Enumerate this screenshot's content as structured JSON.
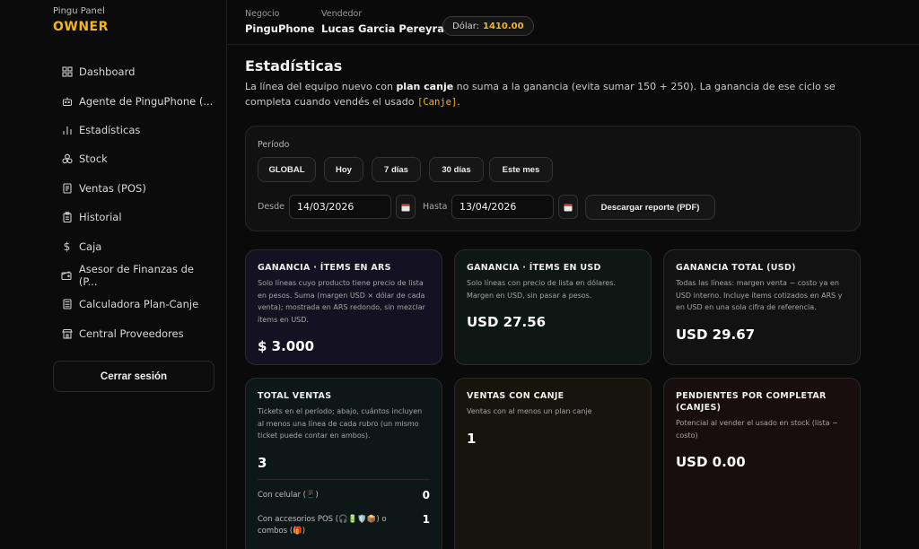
{
  "sidebar": {
    "brand_small": "Pingu Panel",
    "brand_big": "OWNER",
    "items": [
      {
        "label": "Dashboard",
        "icon": "grid-icon"
      },
      {
        "label": "Agente de PinguPhone (...",
        "icon": "bot-icon"
      },
      {
        "label": "Estadísticas",
        "icon": "bar-chart-icon"
      },
      {
        "label": "Stock",
        "icon": "boxes-icon"
      },
      {
        "label": "Ventas (POS)",
        "icon": "receipt-icon"
      },
      {
        "label": "Historial",
        "icon": "clipboard-icon"
      },
      {
        "label": "Caja",
        "icon": "dollar-icon"
      },
      {
        "label": "Asesor de Finanzas de (P...",
        "icon": "wallet-icon"
      },
      {
        "label": "Calculadora Plan-Canje",
        "icon": "calculator-icon"
      },
      {
        "label": "Central Proveedores",
        "icon": "store-icon"
      }
    ],
    "logout_label": "Cerrar sesión"
  },
  "topbar": {
    "negocio_label": "Negocio",
    "negocio_value": "PinguPhone",
    "vendedor_label": "Vendedor",
    "vendedor_value": "Lucas Garcia Pereyra",
    "dolar_label": "Dólar:",
    "dolar_value": "1410.00"
  },
  "main": {
    "title": "Estadísticas",
    "desc_1": "La línea del equipo nuevo con ",
    "desc_bold": "plan canje",
    "desc_2": " no suma a la ganancia (evita sumar 150 + 250). La ganancia de ese ciclo se completa cuando vendés el usado ",
    "desc_code": "[Canje]",
    "desc_3": "."
  },
  "period": {
    "label": "Período",
    "buttons": [
      "GLOBAL",
      "Hoy",
      "7 días",
      "30 días",
      "Este mes"
    ],
    "desde_label": "Desde",
    "desde_value": "14/03/2026",
    "hasta_label": "Hasta",
    "hasta_value": "13/04/2026",
    "pdf_label": "Descargar reporte (PDF)"
  },
  "stats": [
    {
      "title": "GANANCIA · ÍTEMS EN ARS",
      "desc": "Solo líneas cuyo producto tiene precio de lista en pesos. Suma (margen USD × dólar de cada venta); mostrada en ARS redondo, sin mezclar ítems en USD.",
      "value": "$ 3.000"
    },
    {
      "title": "GANANCIA · ÍTEMS EN USD",
      "desc": "Solo líneas con precio de lista en dólares. Margen en USD, sin pasar a pesos.",
      "value": "USD 27.56"
    },
    {
      "title": "GANANCIA TOTAL (USD)",
      "desc": "Todas las líneas: margen venta − costo ya en USD interno. Incluye ítems cotizados en ARS y en USD en una sola cifra de referencia.",
      "value": "USD 29.67"
    },
    {
      "title": "TOTAL VENTAS",
      "desc": "Tickets en el período; abajo, cuántos incluyen al menos una línea de cada rubro (un mismo ticket puede contar en ambos).",
      "value": "3"
    },
    {
      "title": "VENTAS CON CANJE",
      "desc": "Ventas con al menos un plan canje",
      "value": "1"
    },
    {
      "title": "PENDIENTES POR COMPLETAR (CANJES)",
      "desc": "Potencial al vender el usado en stock (lista − costo)",
      "value": "USD 0.00"
    }
  ],
  "ventas_breakdown": {
    "celular_label": "Con celular (📱)",
    "celular_value": "0",
    "accesorios_label": "Con accesorios POS (🎧🔋🛡️📦) o combos (🎁)",
    "accesorios_value": "1"
  }
}
